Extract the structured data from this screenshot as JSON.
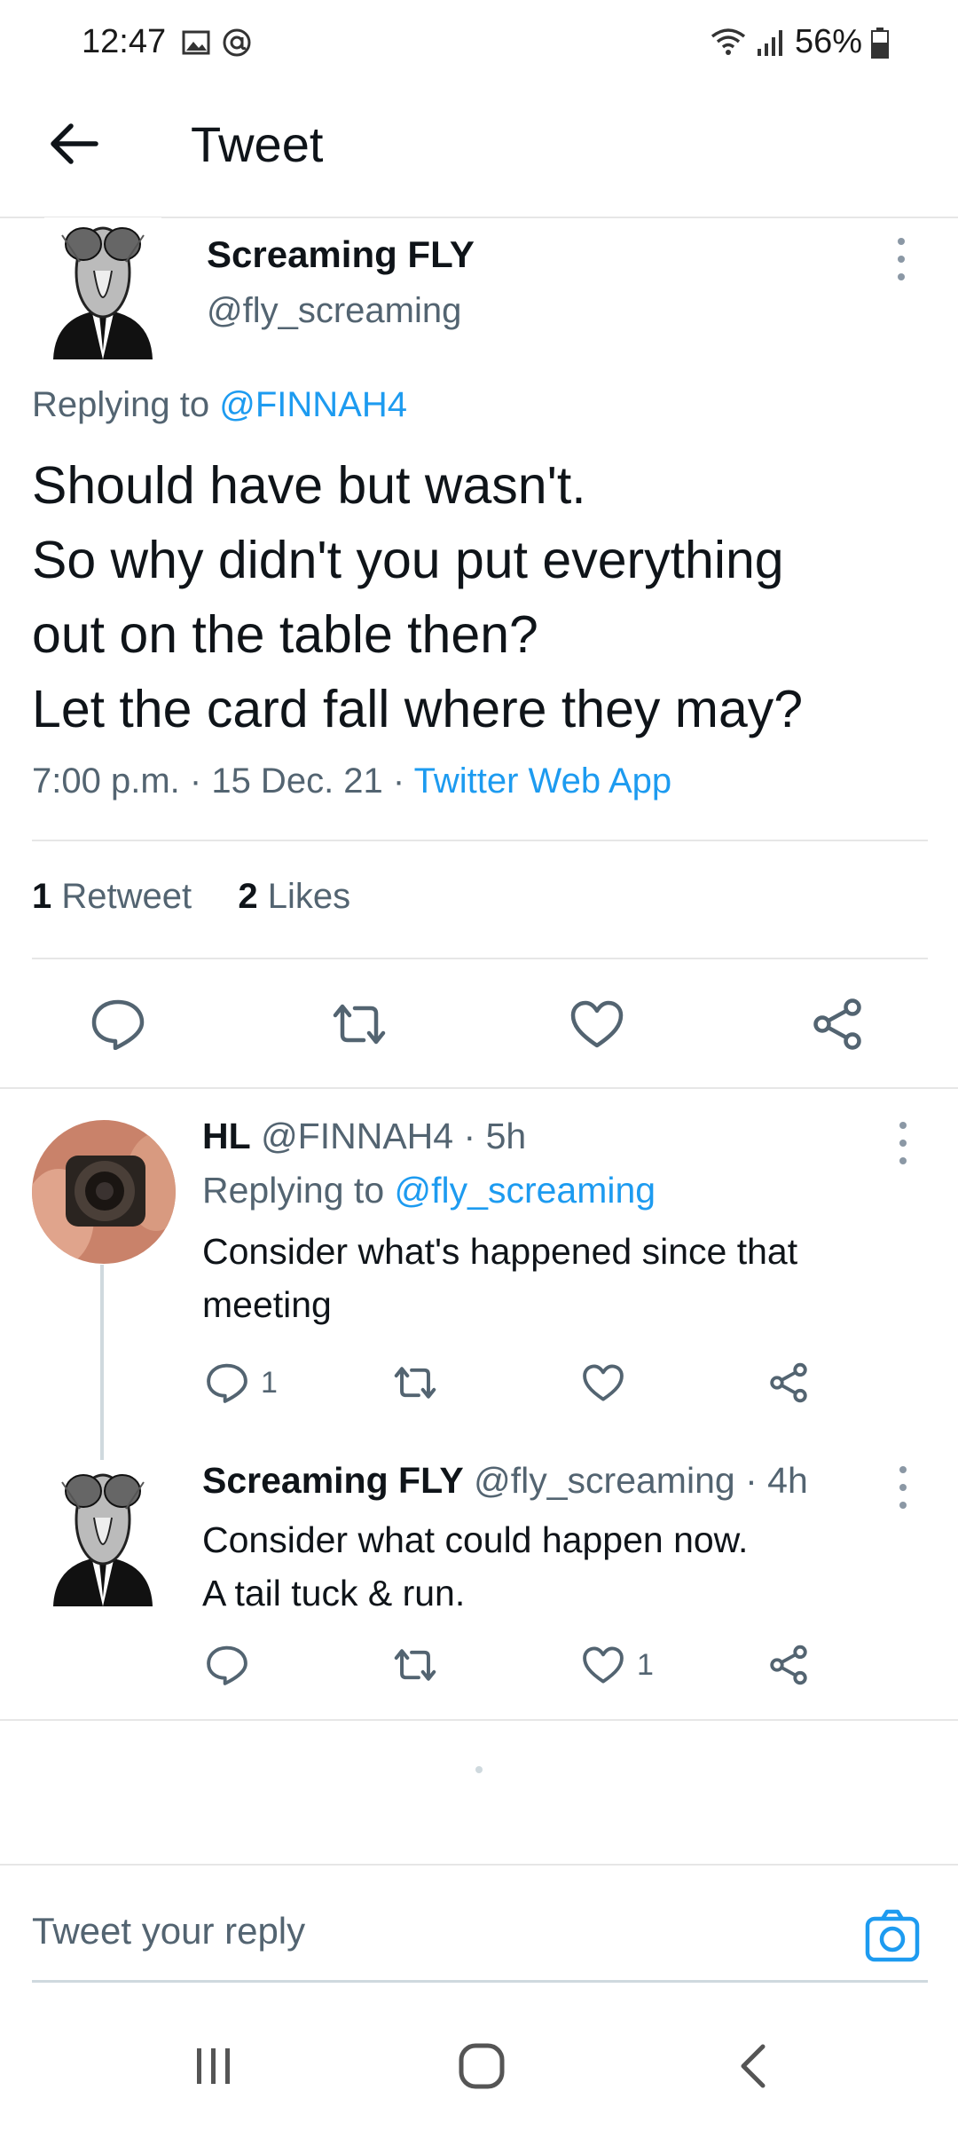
{
  "status_bar": {
    "time": "12:47",
    "battery": "56%"
  },
  "header": {
    "title": "Tweet"
  },
  "main_tweet": {
    "name": "Screaming FLY",
    "handle": "@fly_screaming",
    "replying_prefix": "Replying to ",
    "replying_handle": "@FINNAH4",
    "text_lines": [
      "Should have but wasn't.",
      "So why didn't you put everything",
      "out on the table then?",
      "Let the card fall where they may?"
    ],
    "time": "7:00 p.m.",
    "date": "15 Dec. 21",
    "source": "Twitter Web App",
    "retweet_count": "1",
    "retweet_label": "Retweet",
    "like_count": "2",
    "like_label": "Likes"
  },
  "replies": [
    {
      "name": "HL",
      "handle": "@FINNAH4",
      "age": "5h",
      "replying_prefix": "Replying to ",
      "replying_handle": "@fly_screaming",
      "text_lines": [
        "Consider what's happened since that",
        "meeting"
      ],
      "reply_count": "1",
      "like_count": ""
    },
    {
      "name": "Screaming FLY",
      "handle": "@fly_screaming",
      "age": "4h",
      "text_lines": [
        "Consider what could happen now.",
        "A tail tuck & run."
      ],
      "reply_count": "",
      "like_count": "1"
    }
  ],
  "reply_bar": {
    "placeholder": "Tweet your reply"
  },
  "colors": {
    "accent": "#1d9bf0",
    "text": "#0f1419",
    "secondary": "#536471",
    "divider": "#e6e6e6"
  }
}
